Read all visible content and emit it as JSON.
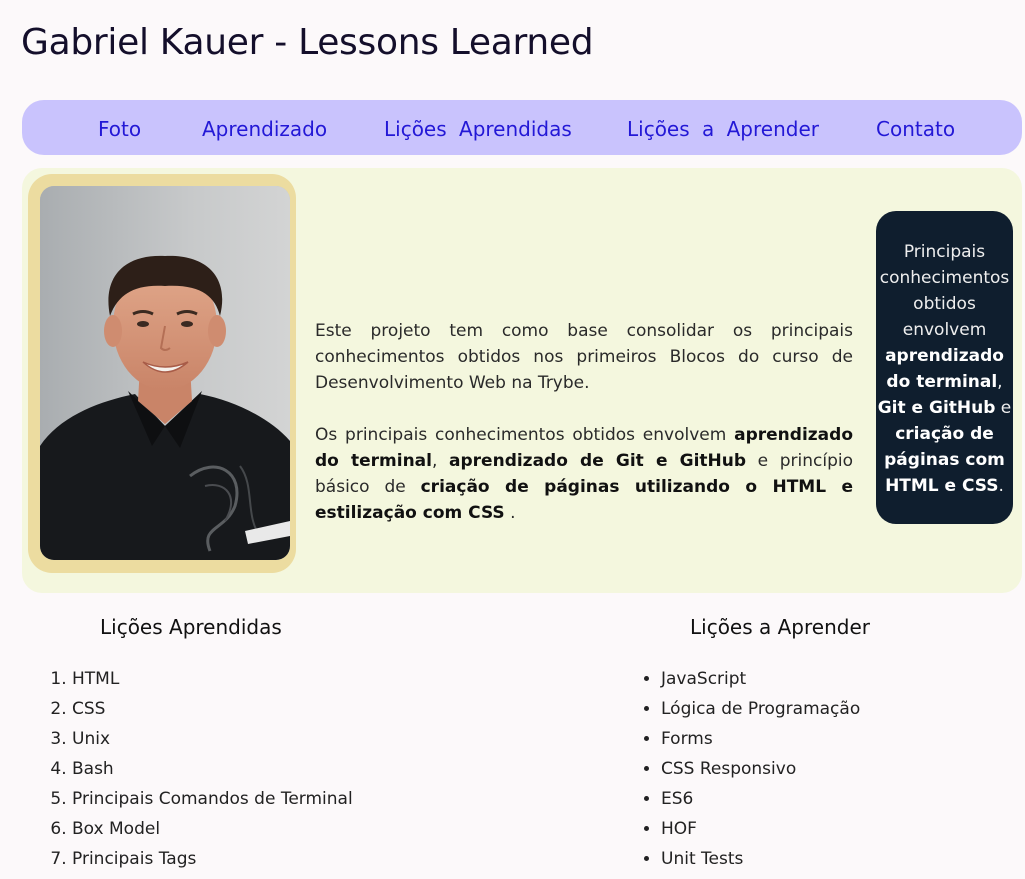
{
  "header": {
    "title": "Gabriel Kauer - Lessons Learned"
  },
  "nav": {
    "items": [
      {
        "label": "Foto"
      },
      {
        "label": "Aprendizado"
      },
      {
        "label": "Lições Aprendidas"
      },
      {
        "label": "Lições a Aprender"
      },
      {
        "label": "Contato"
      }
    ]
  },
  "hero": {
    "paragraph1": "Este projeto tem como base consolidar os principais conhecimentos obtidos nos primeiros Blocos do curso de Desenvolvimento Web na Trybe.",
    "p2_a": "Os principais conhecimentos obtidos envolvem ",
    "p2_b": "aprendizado do terminal",
    "p2_c": ", ",
    "p2_d": "aprendizado de Git e GitHub",
    "p2_e": " e princípio básico de ",
    "p2_f": "criação de páginas utilizando o HTML e estilização com CSS",
    "p2_g": " .",
    "callout": {
      "a": "Principais conhecimentos obtidos envolvem ",
      "b": "aprendizado do terminal",
      "c": ", ",
      "d": "Git e GitHub",
      "e": " e ",
      "f": "criação de páginas com HTML e CSS",
      "g": "."
    }
  },
  "learned": {
    "title": "Lições Aprendidas",
    "items": [
      "HTML",
      "CSS",
      "Unix",
      "Bash",
      "Principais Comandos de Terminal",
      "Box Model",
      "Principais Tags"
    ]
  },
  "to_learn": {
    "title": "Lições a Aprender",
    "items": [
      "JavaScript",
      "Lógica de Programação",
      "Forms",
      "CSS Responsivo",
      "ES6",
      "HOF",
      "Unit Tests"
    ]
  }
}
